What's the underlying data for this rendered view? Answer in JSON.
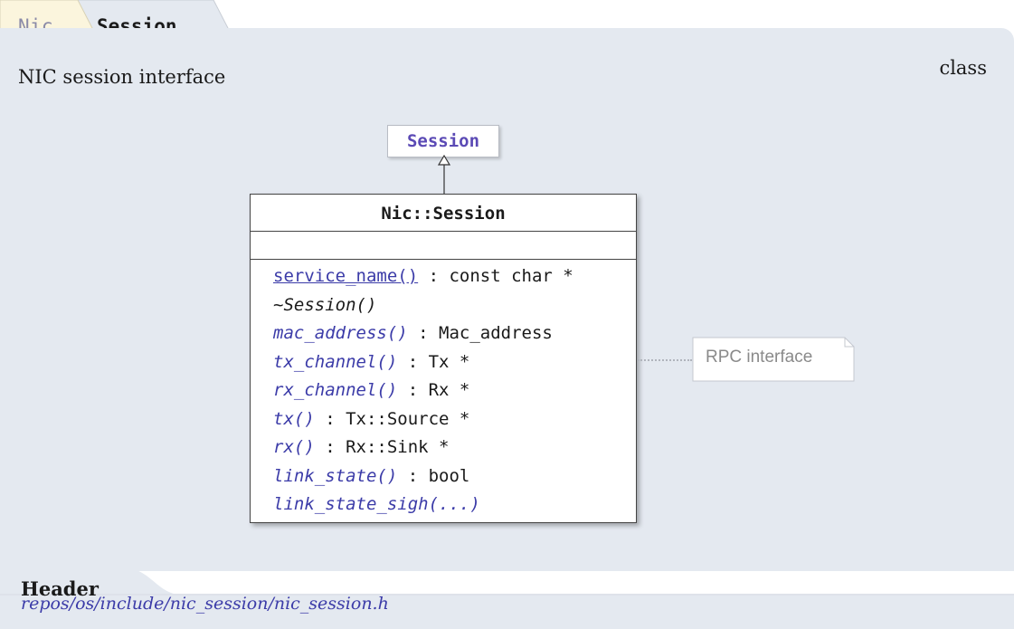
{
  "breadcrumb": {
    "namespace": "Nic",
    "current": "Session"
  },
  "description": "NIC session interface",
  "kind": "class",
  "diagram": {
    "superclass": "Session",
    "class_name": "Nic::Session",
    "operations": [
      {
        "name": "service_name()",
        "type": " : const char *",
        "style": "link"
      },
      {
        "name": "~Session()",
        "type": "",
        "style": "plain"
      },
      {
        "name": "mac_address()",
        "type": " : Mac_address",
        "style": "italic"
      },
      {
        "name": "tx_channel()",
        "type": " : Tx *",
        "style": "italic"
      },
      {
        "name": "rx_channel()",
        "type": " : Rx *",
        "style": "italic"
      },
      {
        "name": "tx()",
        "type": " : Tx::Source *",
        "style": "italic"
      },
      {
        "name": "rx()",
        "type": " : Rx::Sink *",
        "style": "italic"
      },
      {
        "name": "link_state()",
        "type": " : bool",
        "style": "italic"
      },
      {
        "name": "link_state_sigh(...)",
        "type": "",
        "style": "italic"
      }
    ],
    "note": "RPC interface"
  },
  "header": {
    "label": "Header",
    "path": "repos/os/include/nic_session/nic_session.h"
  },
  "colors": {
    "panel": "#e4e9f0",
    "link": "#3b3ba8",
    "superclass": "#5b4ab5"
  }
}
